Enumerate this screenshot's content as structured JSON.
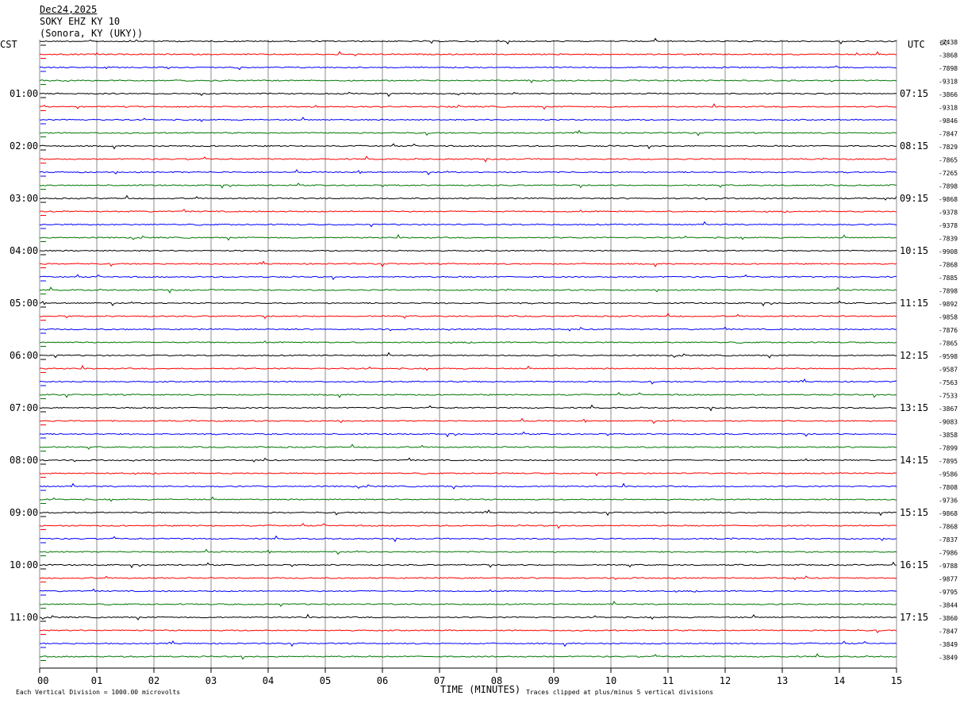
{
  "header": {
    "date": "Dec24,2025",
    "station": "SOKY EHZ KY 10",
    "location": "(Sonora, KY (UKY))"
  },
  "left_tz": "CST",
  "right_tz": "UTC",
  "right_corner_label": "DC",
  "footer": {
    "scale_note": "Each Vertical Division = 1000.00 microvolts",
    "clip_note": "Traces clipped at plus/minus 5 vertical divisions",
    "xlabel": "TIME (MINUTES)"
  },
  "chart_data": {
    "type": "line",
    "title": "SOKY EHZ KY 10",
    "xlabel": "TIME (MINUTES)",
    "xlim": [
      0,
      15
    ],
    "x_ticks": [
      "00",
      "01",
      "02",
      "03",
      "04",
      "05",
      "06",
      "07",
      "08",
      "09",
      "10",
      "11",
      "12",
      "13",
      "14",
      "15"
    ],
    "trace_minutes": 15,
    "trace_count": 48,
    "trace_colors": [
      "#000000",
      "#ff0000",
      "#0000ff",
      "#007700"
    ],
    "left_hour_labels": [
      "01:00",
      "02:00",
      "03:00",
      "04:00",
      "05:00",
      "06:00",
      "07:00",
      "08:00",
      "09:00",
      "10:00",
      "11:00"
    ],
    "right_hour_labels": [
      "07:15",
      "08:15",
      "09:15",
      "10:15",
      "11:15",
      "12:15",
      "13:15",
      "14:15",
      "15:15",
      "16:15",
      "17:15"
    ],
    "dc_offsets": [
      "-7438",
      "-3868",
      "-7898",
      "-9318",
      "-3866",
      "-9318",
      "-9846",
      "-7847",
      "-7829",
      "-7865",
      "-7265",
      "-7898",
      "-9868",
      "-9378",
      "-9378",
      "-7839",
      "-9908",
      "-7868",
      "-7885",
      "-7898",
      "-9892",
      "-9858",
      "-7876",
      "-7865",
      "-9598",
      "-9587",
      "-7563",
      "-7533",
      "-3867",
      "-9083",
      "-3858",
      "-7899",
      "-7895",
      "-9586",
      "-7808",
      "-9736",
      "-9868",
      "-7868",
      "-7837",
      "-7986",
      "-9788",
      "-9877",
      "-9795",
      "-3844",
      "-3860",
      "-7847",
      "-3849",
      "-3849"
    ]
  }
}
